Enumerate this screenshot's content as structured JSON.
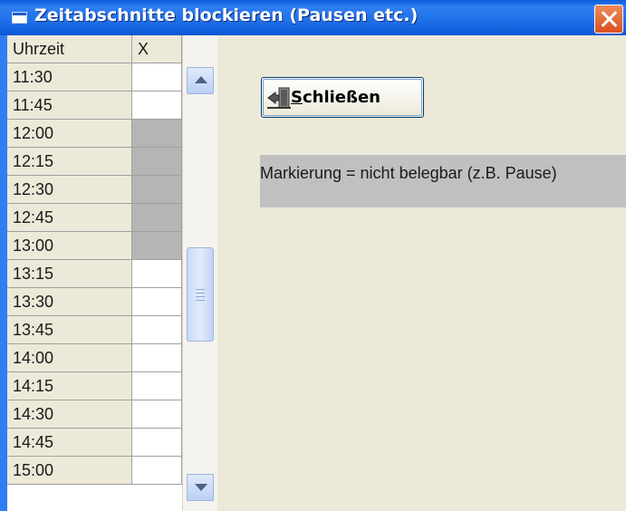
{
  "window": {
    "title": "Zeitabschnitte blockieren (Pausen etc.)"
  },
  "grid": {
    "headers": [
      "Uhrzeit",
      "X"
    ],
    "rows": [
      {
        "time": "11:30",
        "blocked": false
      },
      {
        "time": "11:45",
        "blocked": false
      },
      {
        "time": "12:00",
        "blocked": true
      },
      {
        "time": "12:15",
        "blocked": true
      },
      {
        "time": "12:30",
        "blocked": true
      },
      {
        "time": "12:45",
        "blocked": true
      },
      {
        "time": "13:00",
        "blocked": true
      },
      {
        "time": "13:15",
        "blocked": false
      },
      {
        "time": "13:30",
        "blocked": false
      },
      {
        "time": "13:45",
        "blocked": false
      },
      {
        "time": "14:00",
        "blocked": false
      },
      {
        "time": "14:15",
        "blocked": false
      },
      {
        "time": "14:30",
        "blocked": false
      },
      {
        "time": "14:45",
        "blocked": false
      },
      {
        "time": "15:00",
        "blocked": false
      }
    ]
  },
  "actions": {
    "close_label": "Schließen"
  },
  "legend": {
    "text": "Markierung = nicht belegbar (z.B. Pause)"
  },
  "colors": {
    "titlebar": "#1f6fe9",
    "blocked_cell": "#b5b5b5",
    "background": "#ece9d8"
  }
}
